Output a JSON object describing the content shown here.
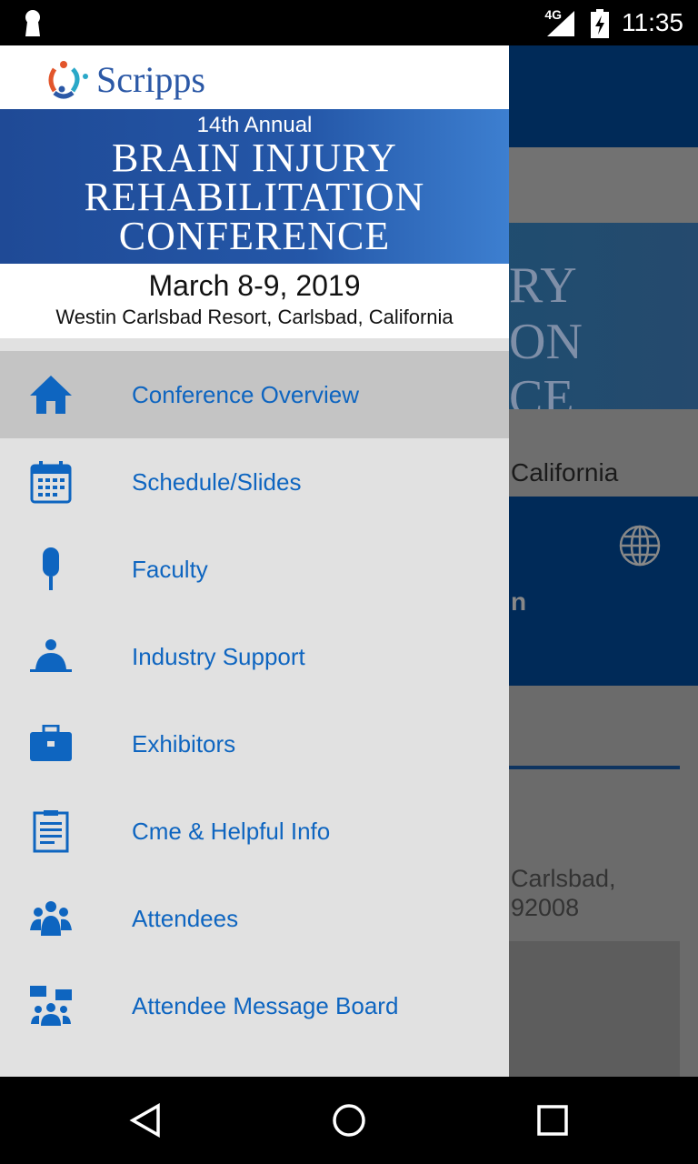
{
  "status_bar": {
    "time": "11:35",
    "network": "4G"
  },
  "drawer": {
    "logo_text": "Scripps",
    "banner": {
      "subtitle": "14th Annual",
      "title_lines": [
        "BRAIN INJURY",
        "REHABILITATION",
        "CONFERENCE"
      ],
      "date": "March 8-9, 2019",
      "venue": "Westin Carlsbad Resort, Carlsbad, California"
    },
    "items": [
      {
        "label": "Conference Overview",
        "icon": "home-icon",
        "active": true
      },
      {
        "label": "Schedule/Slides",
        "icon": "calendar-icon"
      },
      {
        "label": "Faculty",
        "icon": "microphone-icon"
      },
      {
        "label": "Industry Support",
        "icon": "presenter-icon"
      },
      {
        "label": "Exhibitors",
        "icon": "briefcase-icon"
      },
      {
        "label": "Cme & Helpful Info",
        "icon": "clipboard-icon"
      },
      {
        "label": "Attendees",
        "icon": "group-icon"
      },
      {
        "label": "Attendee Message Board",
        "icon": "message-board-icon"
      }
    ]
  },
  "background": {
    "banner_fragment": "RY\nON\nCE",
    "location_fragment": "California",
    "title_fragment": "n",
    "address_lines": [
      "Carlsbad,",
      "92008"
    ]
  },
  "colors": {
    "accent": "#0e65c0",
    "header": "#002a58"
  }
}
